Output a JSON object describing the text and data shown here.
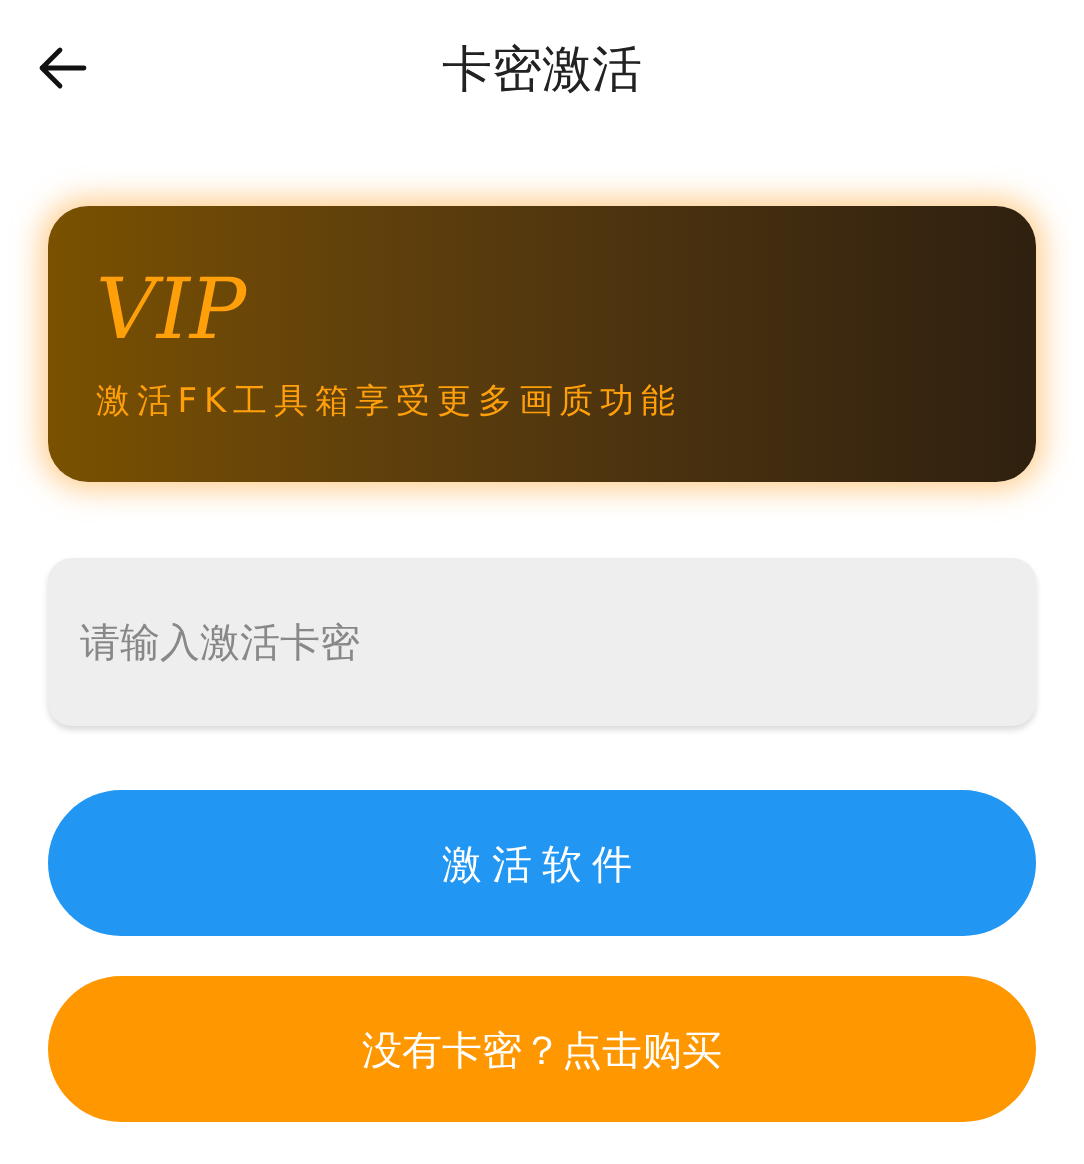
{
  "header": {
    "title": "卡密激活"
  },
  "vip_card": {
    "title": "VIP",
    "subtitle": "激活FK工具箱享受更多画质功能"
  },
  "card_input": {
    "placeholder": "请输入激活卡密"
  },
  "buttons": [
    {
      "label": "激活软件",
      "kind": "primary"
    },
    {
      "label": "没有卡密？点击购买",
      "kind": "secondary"
    }
  ]
}
